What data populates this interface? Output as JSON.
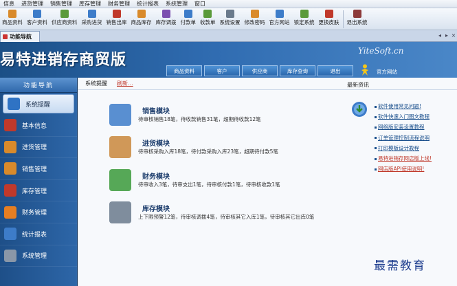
{
  "menu": [
    "信息",
    "进货管理",
    "销售管理",
    "库存管理",
    "财务管理",
    "统计报表",
    "系统管理",
    "窗口"
  ],
  "toolbar": [
    {
      "label": "商品资料",
      "color": "#d98a2b"
    },
    {
      "label": "客户资料",
      "color": "#3d7cc9"
    },
    {
      "label": "供应商资料",
      "color": "#5a9a3a"
    },
    {
      "label": "采购进货",
      "color": "#3d7cc9"
    },
    {
      "label": "销售出库",
      "color": "#c0392b"
    },
    {
      "label": "商品库存",
      "color": "#d98a2b"
    },
    {
      "label": "库存调拨",
      "color": "#7b4fb0"
    },
    {
      "label": "付款单",
      "color": "#3d7cc9"
    },
    {
      "label": "收款单",
      "color": "#5a9a3a"
    },
    {
      "label": "系统设置",
      "color": "#6a7a8c"
    },
    {
      "label": "修改密码",
      "color": "#d98a2b"
    },
    {
      "label": "官方网站",
      "color": "#3d7cc9"
    },
    {
      "label": "锁定系统",
      "color": "#5a9a3a"
    },
    {
      "label": "更换皮肤",
      "color": "#c0392b"
    },
    {
      "label": "退出系统",
      "color": "#8c3a3a"
    }
  ],
  "tab": {
    "label": "功能导航"
  },
  "banner": {
    "title": "易特进销存商贸版",
    "logo": "YiteSoft.cn",
    "tabs": [
      "商品资料",
      "客户",
      "供应商",
      "库存查询",
      "退出"
    ],
    "site_label": "官方网站"
  },
  "sidebar": {
    "title": "功能导航",
    "items": [
      {
        "label": "系统提醒",
        "color": "#2f73c4"
      },
      {
        "label": "基本信息",
        "color": "#c0392b"
      },
      {
        "label": "进货管理",
        "color": "#d98a2b"
      },
      {
        "label": "销售管理",
        "color": "#d98a2b"
      },
      {
        "label": "库存管理",
        "color": "#c0392b"
      },
      {
        "label": "财务管理",
        "color": "#e67e22"
      },
      {
        "label": "统计报表",
        "color": "#3d7cc9"
      },
      {
        "label": "系统管理",
        "color": "#8a97a8"
      }
    ]
  },
  "main": {
    "heading": "系统提醒",
    "refresh": "刷新...",
    "news_title": "最新资讯",
    "modules": [
      {
        "title": "销售模块",
        "text": "待审核销售18笔，待收款销售31笔，超期待收款12笔",
        "color": "#3d7cc9"
      },
      {
        "title": "进货模块",
        "text": "待审核采购入库18笔，待付款采购入库23笔，超期待付款5笔",
        "color": "#c9873b"
      },
      {
        "title": "财务模块",
        "text": "待审收入3笔，待审支出1笔，待审核付款1笔，待审核收款1笔",
        "color": "#3a9a3a"
      },
      {
        "title": "库存模块",
        "text": "上下限预警12笔，待审核调拨4笔，待审核其它入库1笔，待审核其它出库0笔",
        "color": "#6a7a8c"
      }
    ],
    "news": [
      {
        "text": "软件使用常见问题!",
        "color": "blue"
      },
      {
        "text": "软件快速入门图文教程",
        "color": "blue"
      },
      {
        "text": "网络版安装设置教程",
        "color": "blue"
      },
      {
        "text": "订单管理控制流程说明",
        "color": "blue"
      },
      {
        "text": "打印模板设计教程",
        "color": "blue"
      },
      {
        "text": "易特进销存网店版上线!",
        "color": "red"
      },
      {
        "text": "网店版API使用说明!",
        "color": "red"
      }
    ]
  },
  "watermark": "最需教育"
}
